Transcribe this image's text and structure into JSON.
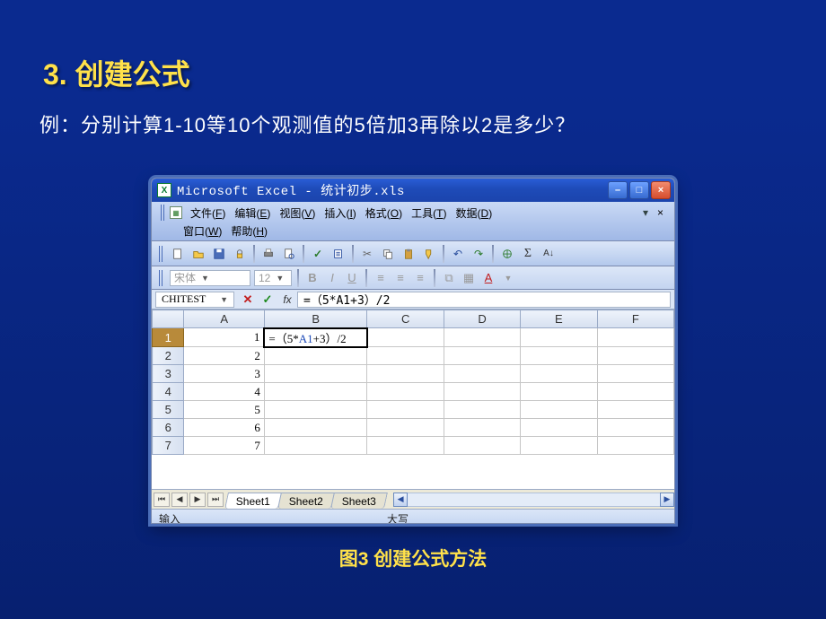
{
  "slide": {
    "title": "3. 创建公式",
    "example": "例：分别计算1-10等10个观测值的5倍加3再除以2是多少？",
    "caption": "图3 创建公式方法"
  },
  "window": {
    "app": "Microsoft Excel",
    "sep": " - ",
    "doc": "统计初步.xls",
    "min": "–",
    "max": "□",
    "close": "×"
  },
  "menu": {
    "file": {
      "label": "文件",
      "key": "F"
    },
    "edit": {
      "label": "编辑",
      "key": "E"
    },
    "view": {
      "label": "视图",
      "key": "V"
    },
    "insert": {
      "label": "插入",
      "key": "I"
    },
    "format": {
      "label": "格式",
      "key": "O"
    },
    "tools": {
      "label": "工具",
      "key": "T"
    },
    "data": {
      "label": "数据",
      "key": "D"
    },
    "window": {
      "label": "窗口",
      "key": "W"
    },
    "help": {
      "label": "帮助",
      "key": "H"
    }
  },
  "fontbar": {
    "font": "宋体",
    "size": "12",
    "bold": "B",
    "italic": "I",
    "underline": "U"
  },
  "formula": {
    "namebox": "CHITEST",
    "value": "=（5*A1+3）/2",
    "cell_prefix": "=（5*",
    "cell_ref": "A1",
    "cell_suffix": "+3）/2"
  },
  "columns": [
    "A",
    "B",
    "C",
    "D",
    "E",
    "F"
  ],
  "rows": [
    {
      "n": "1",
      "a": "1"
    },
    {
      "n": "2",
      "a": "2"
    },
    {
      "n": "3",
      "a": "3"
    },
    {
      "n": "4",
      "a": "4"
    },
    {
      "n": "5",
      "a": "5"
    },
    {
      "n": "6",
      "a": "6"
    },
    {
      "n": "7",
      "a": "7"
    }
  ],
  "tabs": {
    "sheet1": "Sheet1",
    "sheet2": "Sheet2",
    "sheet3": "Sheet3"
  },
  "status": {
    "mode": "输入",
    "caps": "大写"
  }
}
